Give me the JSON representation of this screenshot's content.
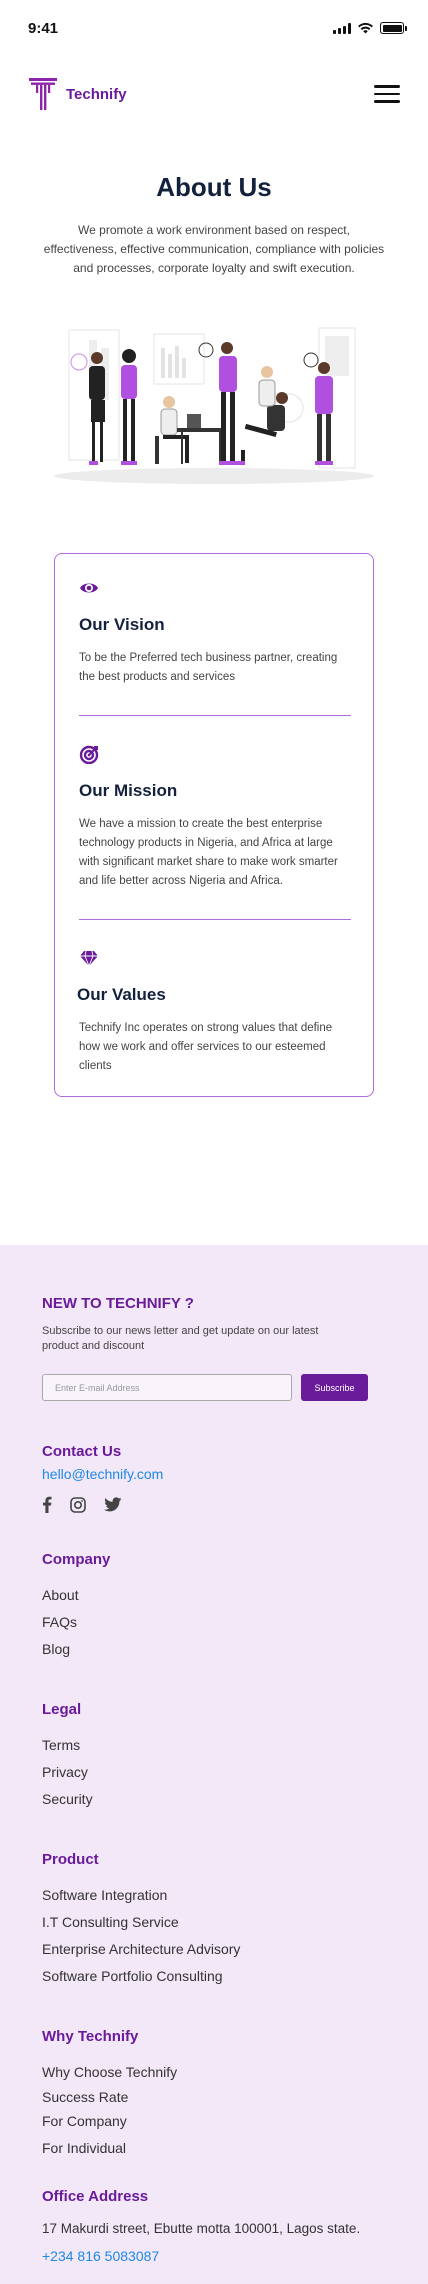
{
  "status_bar": {
    "time": "9:41"
  },
  "header": {
    "brand": "Technify",
    "logo_letter": "T"
  },
  "about": {
    "title": "About Us",
    "description": "We promote a work environment based on respect, effectiveness, effective communication, compliance with policies and processes, corporate loyalty and swift execution."
  },
  "card": {
    "vision": {
      "icon": "eye-icon",
      "title": "Our Vision",
      "text": "To be the Preferred tech business partner, creating the best products and services"
    },
    "mission": {
      "icon": "target-icon",
      "title": "Our Mission",
      "text": "We have a mission to create the best enterprise technology products in Nigeria, and Africa at large with significant market share to make work smarter and life better across Nigeria and Africa."
    },
    "values": {
      "icon": "diamond-icon",
      "title": "Our Values",
      "text": "Technify Inc  operates on strong values that define how we work and offer services to our esteemed clients"
    }
  },
  "footer": {
    "newsletter": {
      "title": "NEW TO TECHNIFY ?",
      "text": "Subscribe to our news letter and get update on our latest product and discount",
      "placeholder": "Enter E-mail Address",
      "button": "Subscribe"
    },
    "contact": {
      "title": "Contact Us",
      "email": "hello@technify.com",
      "socials": [
        "facebook-icon",
        "instagram-icon",
        "twitter-icon"
      ]
    },
    "company": {
      "title": "Company",
      "items": [
        "About",
        "FAQs",
        "Blog"
      ]
    },
    "legal": {
      "title": "Legal",
      "items": [
        "Terms",
        "Privacy",
        "Security"
      ]
    },
    "product": {
      "title": "Product",
      "items": [
        "Software Integration",
        "I.T Consulting Service",
        "Enterprise Architecture Advisory",
        "Software Portfolio Consulting"
      ]
    },
    "why": {
      "title": "Why Technify",
      "items": [
        "Why Choose Technify",
        "Success Rate",
        "For Company",
        "For Individual"
      ]
    },
    "address": {
      "title": "Office Address",
      "text": "17 Makurdi street, Ebutte motta 100001, Lagos state.",
      "phone": "+234 816 5083087"
    }
  },
  "colors": {
    "brand": "#6a1b9a",
    "accent": "#b36be0",
    "link": "#1e88e5",
    "footer_bg": "#f3e8f8"
  }
}
